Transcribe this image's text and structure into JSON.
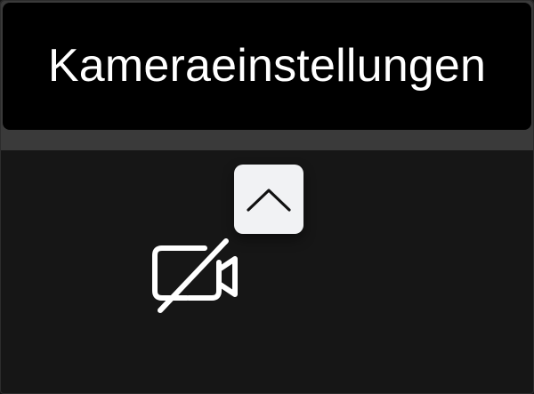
{
  "tooltip": {
    "text": "Kameraeinstellungen"
  },
  "controls": {
    "settings_toggle_icon": "chevron-up-icon",
    "camera_icon": "camera-off-icon"
  },
  "colors": {
    "background": "#161616",
    "tooltip_background": "#000000",
    "tooltip_text": "#ffffff",
    "toggle_background": "#f1f2f4",
    "icon_light": "#ffffff",
    "icon_dark": "#111111"
  }
}
